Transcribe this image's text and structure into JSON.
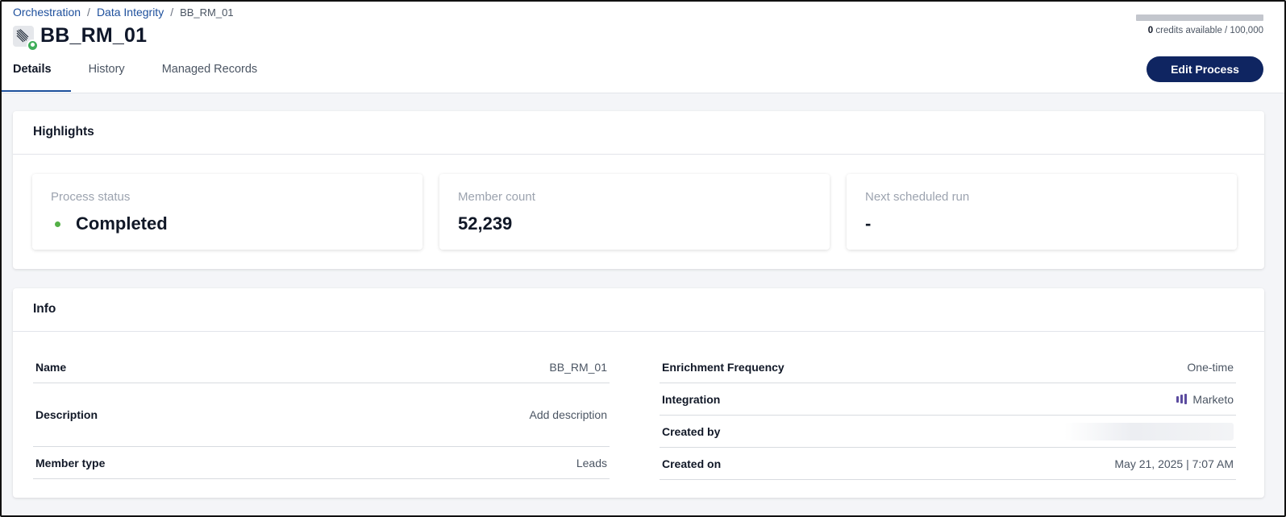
{
  "breadcrumb": {
    "items": [
      "Orchestration",
      "Data Integrity"
    ],
    "separator": "/",
    "current": "BB_RM_01"
  },
  "title": "BB_RM_01",
  "credits": {
    "available": "0",
    "suffix": " credits available / 100,000",
    "used_fraction": 0
  },
  "tabs": [
    {
      "label": "Details",
      "active": true
    },
    {
      "label": "History",
      "active": false
    },
    {
      "label": "Managed Records",
      "active": false
    }
  ],
  "edit_button": "Edit Process",
  "highlights": {
    "heading": "Highlights",
    "status": {
      "label": "Process status",
      "value": "Completed"
    },
    "member_count": {
      "label": "Member count",
      "value": "52,239"
    },
    "next_run": {
      "label": "Next scheduled run",
      "value": "-"
    }
  },
  "info": {
    "heading": "Info",
    "left": [
      {
        "key": "Name",
        "value": "BB_RM_01"
      },
      {
        "key": "Description",
        "value": "Add description"
      },
      {
        "key": "Member type",
        "value": "Leads"
      }
    ],
    "right": [
      {
        "key": "Enrichment Frequency",
        "value": "One-time"
      },
      {
        "key": "Integration",
        "value": "Marketo",
        "icon": "marketo-icon"
      },
      {
        "key": "Created by",
        "value": ""
      },
      {
        "key": "Created on",
        "value": "May 21, 2025 | 7:07 AM"
      }
    ]
  },
  "colors": {
    "accent": "#1d4f9c",
    "button": "#0f2561",
    "status_green": "#54b046",
    "marketo": "#5c4c9f"
  }
}
